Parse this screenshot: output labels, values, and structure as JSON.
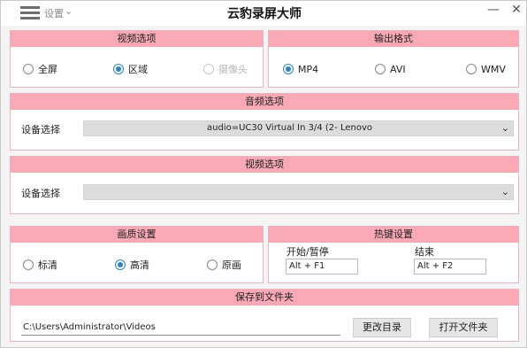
{
  "titlebar": {
    "settings_label": "设置",
    "title": "云豹录屏大师",
    "minimize": "—",
    "close": "✕"
  },
  "video_options": {
    "header": "视频选项",
    "options": [
      "全屏",
      "区域",
      "摄像头"
    ],
    "selected": "区域",
    "disabled": "摄像头"
  },
  "output_format": {
    "header": "输出格式",
    "options": [
      "MP4",
      "AVI",
      "WMV"
    ],
    "selected": "MP4"
  },
  "audio_options": {
    "header": "音频选项",
    "device_label": "设备选择",
    "device_value": "audio=UC30 Virtual In 3/4 (2- Lenovo"
  },
  "video_device": {
    "header": "视频选项",
    "device_label": "设备选择",
    "device_value": ""
  },
  "quality": {
    "header": "画质设置",
    "options": [
      "标清",
      "高清",
      "原画"
    ],
    "selected": "高清"
  },
  "hotkeys": {
    "header": "热键设置",
    "start_label": "开始/暂停",
    "start_value": "Alt + F1",
    "end_label": "结束",
    "end_value": "Alt + F2"
  },
  "save": {
    "header": "保存到文件夹",
    "path": "C:\\Users\\Administrator\\Videos",
    "change_dir_button": "更改目录",
    "open_folder_button": "打开文件夹"
  },
  "icons": {
    "menu": "menu-icon",
    "dropdown": "chevron-down-icon"
  },
  "colors": {
    "header_pink": "#f9a9b6",
    "radio_selected": "#2f7fc2"
  }
}
